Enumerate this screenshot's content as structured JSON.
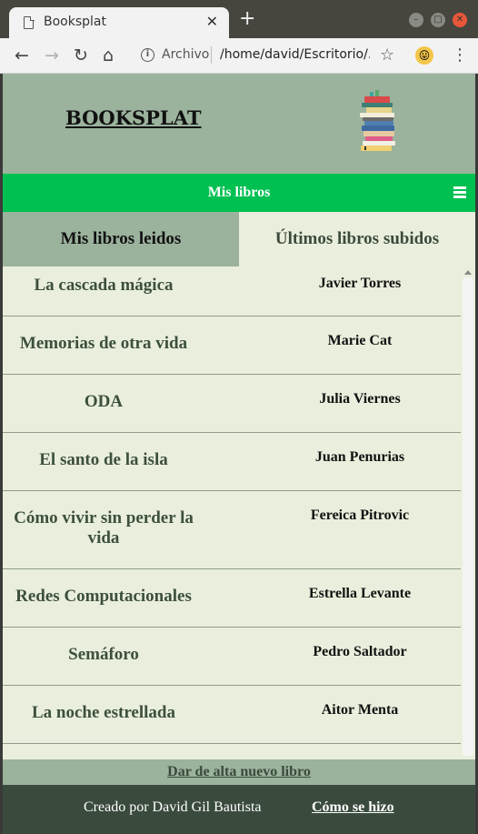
{
  "browser": {
    "tab_title": "Booksplat",
    "close_tab": "✕",
    "new_tab": "+",
    "url_scheme": "Archivo",
    "url": "/home/david/Escritorio/...",
    "window_buttons": [
      "–",
      "□",
      "✕"
    ]
  },
  "header": {
    "site_title": "BOOKSPLAT",
    "logo_icon": "stack-of-books-icon"
  },
  "navbar": {
    "title": "Mis libros",
    "menu_icon": "hamburger-icon"
  },
  "tabs": [
    {
      "label": "Mis libros leidos",
      "active": true
    },
    {
      "label": "Últimos libros subidos",
      "active": false
    }
  ],
  "books": [
    {
      "title": "La cascada mágica",
      "author": "Javier Torres"
    },
    {
      "title": "Memorias de otra vida",
      "author": "Marie Cat"
    },
    {
      "title": "ODA",
      "author": "Julia Viernes"
    },
    {
      "title": "El santo de la isla",
      "author": "Juan Penurias"
    },
    {
      "title": "Cómo vivir sin perder la vida",
      "author": "Fereica Pitrovic"
    },
    {
      "title": "Redes Computacionales",
      "author": "Estrella Levante"
    },
    {
      "title": "Semáforo",
      "author": "Pedro Saltador"
    },
    {
      "title": "La noche estrellada",
      "author": "Aitor Menta"
    },
    {
      "title": "",
      "author": ""
    }
  ],
  "actions": {
    "add_book": "Dar de alta nuevo libro"
  },
  "footer": {
    "credit": "Creado por David Gil Bautista",
    "how_link": "Cómo se hizo"
  },
  "colors": {
    "header_bg": "#9bb29d",
    "nav_bg": "#00c051",
    "page_bg": "#e9efdc",
    "footer_bg": "#3a4b3e"
  }
}
